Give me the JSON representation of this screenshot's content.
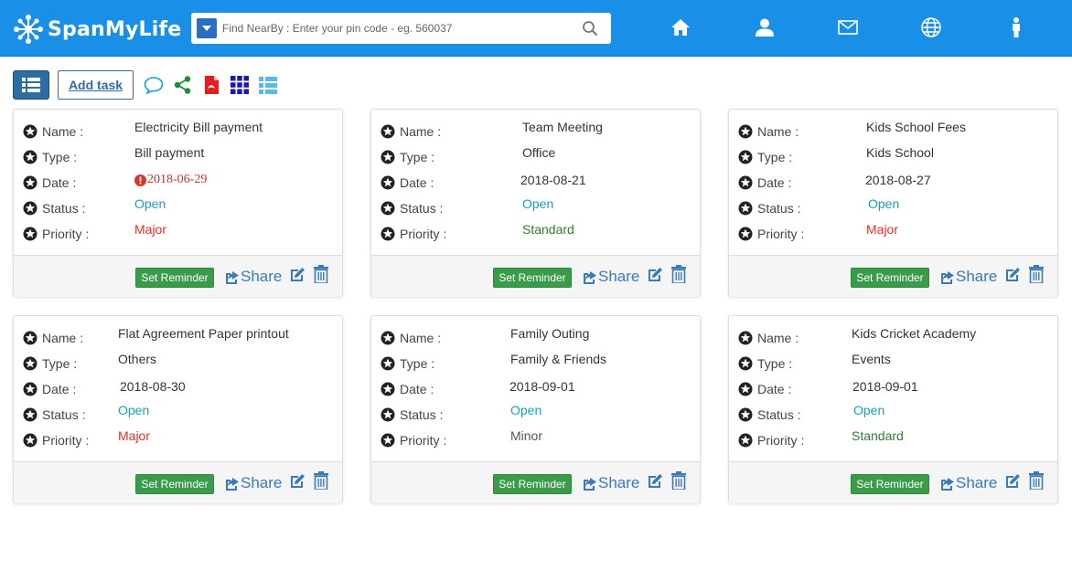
{
  "header": {
    "logo_text": "SpanMyLife",
    "search": {
      "placeholder": "Find NearBy : Enter your pin code - eg. 560037",
      "value": ""
    },
    "nav_icons": [
      "home-icon",
      "user-icon",
      "envelope-icon",
      "globe-icon",
      "person-icon"
    ]
  },
  "toolbar": {
    "add_task_label": "Add task",
    "icons": [
      "comment-icon",
      "share-alt-icon",
      "pdf-icon",
      "grid-icon",
      "list-icon"
    ]
  },
  "labels": {
    "name": "Name :",
    "type": "Type :",
    "date": "Date :",
    "status": "Status :",
    "priority": "Priority :",
    "set_reminder": "Set Reminder",
    "share": "Share"
  },
  "colors": {
    "header": "#1a8fe8",
    "open": "#17a2b8",
    "major": "#d9342b",
    "standard": "#2e7d32",
    "reminder": "#3b9b4a",
    "link": "#3a7ab8"
  },
  "tasks": [
    {
      "name": "Electricity Bill payment",
      "type": "Bill payment",
      "date": "2018-06-29",
      "overdue": true,
      "status": "Open",
      "priority": "Major"
    },
    {
      "name": "Team Meeting",
      "type": "Office",
      "date": "2018-08-21",
      "overdue": false,
      "status": "Open",
      "priority": "Standard"
    },
    {
      "name": "Kids School Fees",
      "type": "Kids School",
      "date": "2018-08-27",
      "overdue": false,
      "status": "Open",
      "priority": "Major"
    },
    {
      "name": "Flat Agreement Paper printout",
      "type": "Others",
      "date": "2018-08-30",
      "overdue": false,
      "status": "Open",
      "priority": "Major"
    },
    {
      "name": "Family Outing",
      "type": "Family & Friends",
      "date": "2018-09-01",
      "overdue": false,
      "status": "Open",
      "priority": "Minor"
    },
    {
      "name": "Kids Cricket Academy",
      "type": "Events",
      "date": "2018-09-01",
      "overdue": false,
      "status": "Open",
      "priority": "Standard"
    }
  ]
}
